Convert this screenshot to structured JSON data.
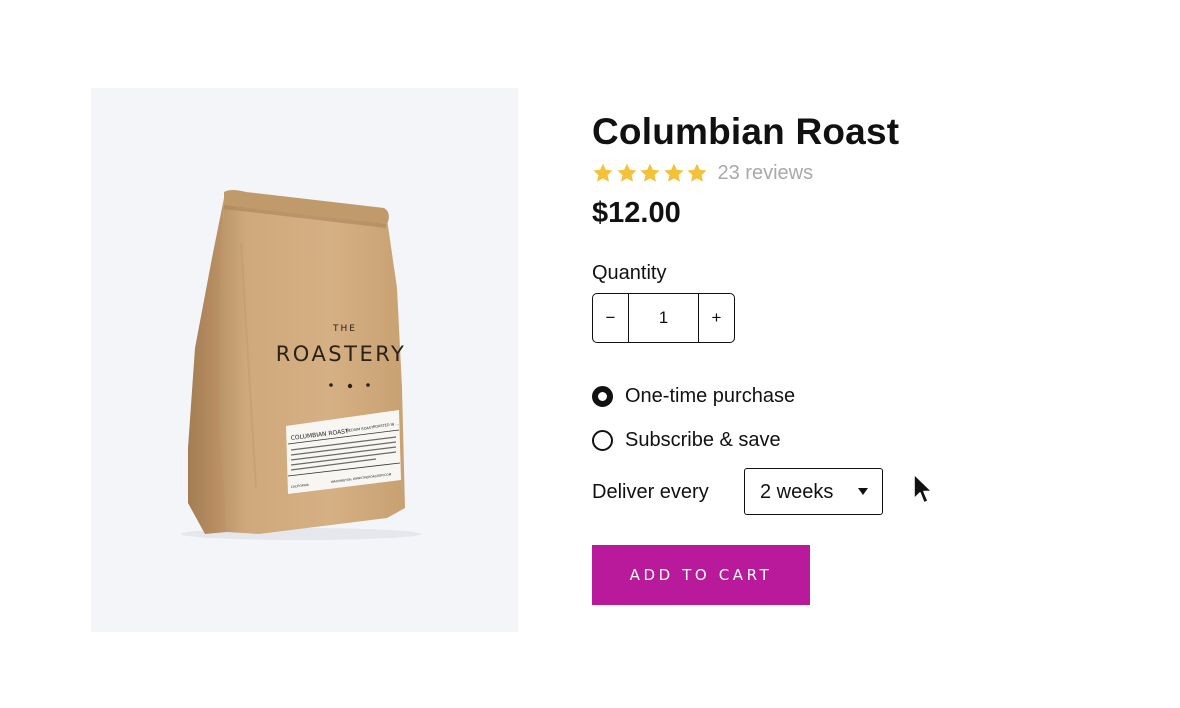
{
  "product": {
    "title": "Columbian Roast",
    "rating": 5,
    "reviews": "23 reviews",
    "price": "$12.00",
    "image": {
      "brand_small": "THE",
      "brand": "ROASTERY",
      "label_name": "COLUMBIAN ROAST",
      "label_col2": "MEDIUM ROAST",
      "label_col3": "ROASTED IN ...",
      "label_foot1": "CALIFORNIA",
      "label_foot2": "WASHINGTON",
      "label_foot3": "WWW.THEROASTERY.COM"
    }
  },
  "quantity": {
    "label": "Quantity",
    "minus": "−",
    "value": "1",
    "plus": "+"
  },
  "purchase_options": [
    {
      "label": "One-time purchase",
      "checked": true
    },
    {
      "label": "Subscribe & save",
      "checked": false
    }
  ],
  "delivery": {
    "label": "Deliver every",
    "selected": "2 weeks"
  },
  "cart": {
    "label": "ADD TO CART"
  },
  "colors": {
    "accent": "#b9199b",
    "star": "#f3c13a",
    "image_bg": "#f4f5f9",
    "muted_text": "#a9a9a9"
  },
  "icons": {
    "star": "star-icon",
    "dropdown": "chevron-down-icon",
    "cursor": "mouse-pointer-icon"
  }
}
